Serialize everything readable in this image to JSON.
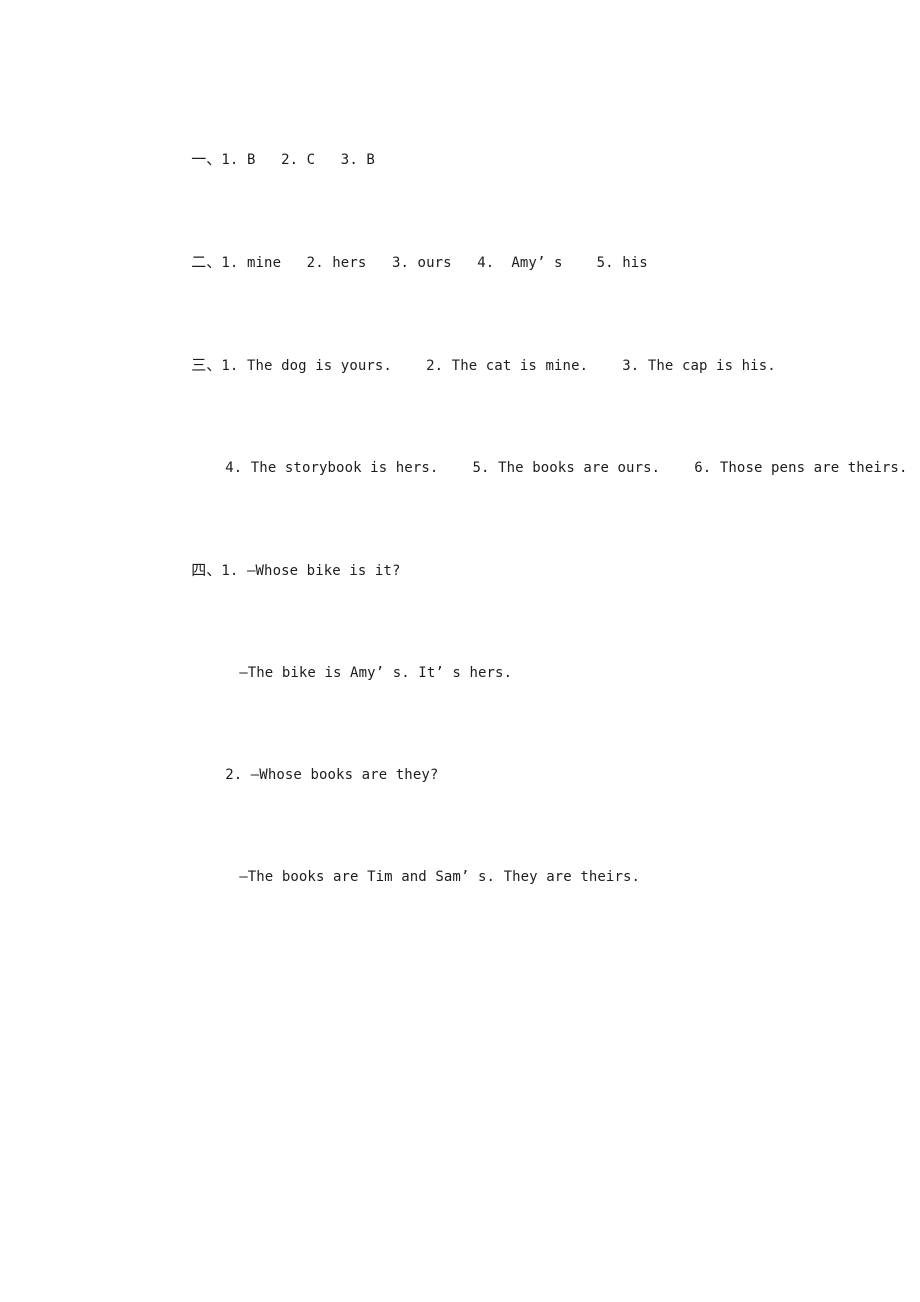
{
  "document": {
    "kind": "answer-key",
    "page_background": "#ffffff",
    "text_color": "#1d1d1d",
    "sections": [
      {
        "marker": "一、",
        "id": "section-1",
        "lines": [
          {
            "id": "s1-l1",
            "indent": "none",
            "marker": "一、",
            "text": "1. B   2. C   3. B"
          }
        ]
      },
      {
        "marker": "二、",
        "id": "section-2",
        "lines": [
          {
            "id": "s2-l1",
            "indent": "none",
            "marker": "二、",
            "text": "1. mine   2. hers   3. ours   4.  Amy’ s    5. his"
          }
        ]
      },
      {
        "marker": "三、",
        "id": "section-3",
        "lines": [
          {
            "id": "s3-l1",
            "indent": "none",
            "marker": "三、",
            "text": "1. The dog is yours.    2. The cat is mine.    3. The cap is his."
          },
          {
            "id": "s3-l2",
            "indent": "indent-1",
            "marker": "",
            "text": "4. The storybook is hers.    5. The books are ours.    6. Those pens are theirs."
          }
        ]
      },
      {
        "marker": "四、",
        "id": "section-4",
        "lines": [
          {
            "id": "s4-l1",
            "indent": "none",
            "marker": "四、",
            "text": "1. —Whose bike is it?"
          },
          {
            "id": "s4-l2",
            "indent": "indent-3",
            "marker": "",
            "text": "—The bike is Amy’ s. It’ s hers."
          },
          {
            "id": "s4-l3",
            "indent": "indent-1",
            "marker": "",
            "text": "2. —Whose books are they?"
          },
          {
            "id": "s4-l4",
            "indent": "indent-3",
            "marker": "",
            "text": "—The books are Tim and Sam’ s. They are theirs."
          }
        ]
      }
    ],
    "flat_lines": [
      {
        "marker": "一、",
        "indent": "none",
        "text": "1. B   2. C   3. B"
      },
      {
        "marker": "二、",
        "indent": "none",
        "text": "1. mine   2. hers   3. ours   4.  Amy’ s    5. his"
      },
      {
        "marker": "三、",
        "indent": "none",
        "text": "1. The dog is yours.    2. The cat is mine.    3. The cap is his."
      },
      {
        "marker": "",
        "indent": "indent-1",
        "text": "4. The storybook is hers.    5. The books are ours.    6. Those pens are theirs."
      },
      {
        "marker": "四、",
        "indent": "none",
        "text": "1. —Whose bike is it?"
      },
      {
        "marker": "",
        "indent": "indent-3",
        "text": "—The bike is Amy’ s. It’ s hers."
      },
      {
        "marker": "",
        "indent": "indent-1",
        "text": "2. —Whose books are they?"
      },
      {
        "marker": "",
        "indent": "indent-3",
        "text": "—The books are Tim and Sam’ s. They are theirs."
      }
    ]
  }
}
